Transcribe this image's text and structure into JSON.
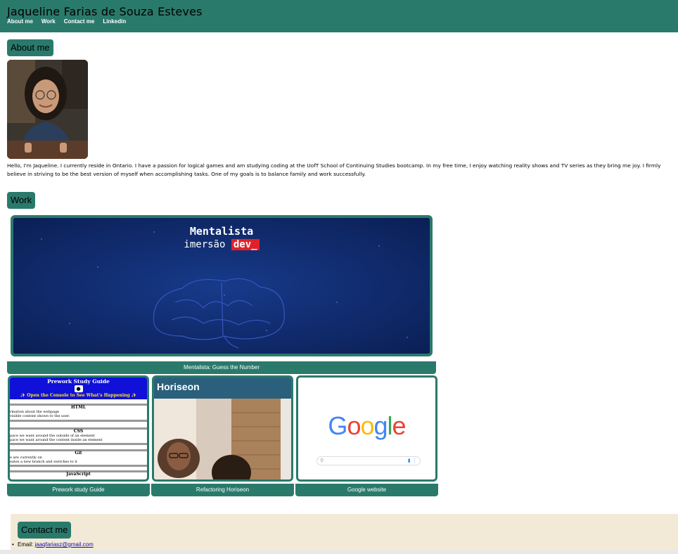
{
  "header": {
    "title": "Jaqueline Farias de Souza Esteves",
    "nav": [
      {
        "label": "About me"
      },
      {
        "label": "Work"
      },
      {
        "label": "Contact me"
      },
      {
        "label": "Linkedin"
      }
    ]
  },
  "about": {
    "heading": "About me",
    "text": "Hello, I'm Jaqueline. I currently reside in Ontario. I have a passion for logical games and am studying coding at the UofT School of Continuing Studies bootcamp. In my free time, I enjoy watching reality shows and TV series as they bring me joy. I firmly believe in striving to be the best version of myself when accomplishing tasks. One of my goals is to balance family and work successfully."
  },
  "work": {
    "heading": "Work",
    "featured": {
      "caption": "Mentalista: Guess the Number",
      "image_title": "Mentalista",
      "image_sub": "imersão",
      "image_badge": "dev_"
    },
    "projects": [
      {
        "caption": "Prework study Guide",
        "preview": {
          "title": "Prework Study Guide",
          "subtitle": "✨ Open the Console to See What's Happening ✨",
          "sections": [
            {
              "head": "HTML",
              "lines": [
                "rmation about the webpage",
                "visible content shown to the user."
              ]
            },
            {
              "head": "CSS",
              "lines": [
                "pace we want around the outside of an element",
                "pace we want around the content inside an element"
              ]
            },
            {
              "head": "Git",
              "lines": [
                "e are currently on",
                "eates a new branch and switches to it"
              ]
            },
            {
              "head": "JavaScript",
              "lines": []
            }
          ]
        }
      },
      {
        "caption": "Refactoring Horiseon",
        "preview": {
          "title": "Horiseon"
        }
      },
      {
        "caption": "Google website",
        "preview": {
          "logo": "Google"
        }
      }
    ]
  },
  "contact": {
    "heading": "Contact me",
    "email_label": "Email:",
    "email": "jaaqfariasz@gmail.com"
  }
}
